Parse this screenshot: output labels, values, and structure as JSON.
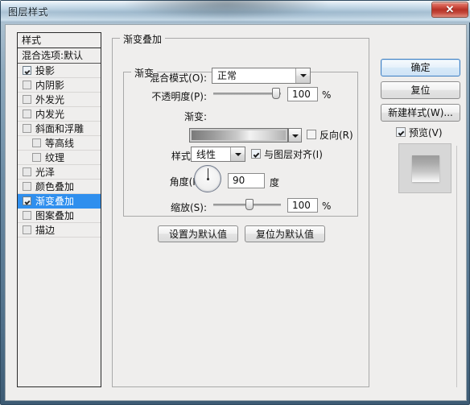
{
  "window": {
    "title": "图层样式",
    "close_label": "✕"
  },
  "styles_panel": {
    "header": "样式",
    "blend_options": "混合选项:默认",
    "effects": [
      {
        "label": "投影",
        "checked": true,
        "selected": false,
        "indent": false
      },
      {
        "label": "内阴影",
        "checked": false,
        "selected": false,
        "indent": false
      },
      {
        "label": "外发光",
        "checked": false,
        "selected": false,
        "indent": false
      },
      {
        "label": "内发光",
        "checked": false,
        "selected": false,
        "indent": false
      },
      {
        "label": "斜面和浮雕",
        "checked": false,
        "selected": false,
        "indent": false
      },
      {
        "label": "等高线",
        "checked": false,
        "selected": false,
        "indent": true
      },
      {
        "label": "纹理",
        "checked": false,
        "selected": false,
        "indent": true
      },
      {
        "label": "光泽",
        "checked": false,
        "selected": false,
        "indent": false
      },
      {
        "label": "颜色叠加",
        "checked": false,
        "selected": false,
        "indent": false
      },
      {
        "label": "渐变叠加",
        "checked": true,
        "selected": true,
        "indent": false
      },
      {
        "label": "图案叠加",
        "checked": false,
        "selected": false,
        "indent": false
      },
      {
        "label": "描边",
        "checked": false,
        "selected": false,
        "indent": false
      }
    ]
  },
  "main": {
    "outer_group_title": "渐变叠加",
    "inner_group_title": "渐变",
    "blend_mode": {
      "label": "混合模式(O):",
      "value": "正常"
    },
    "opacity": {
      "label": "不透明度(P):",
      "value": "100",
      "unit": "%",
      "slider_percent": 100
    },
    "gradient": {
      "label": "渐变:",
      "reverse_label": "反向(R)",
      "reverse_checked": false
    },
    "style": {
      "label": "样式(L):",
      "value": "线性",
      "align_label": "与图层对齐(I)",
      "align_checked": true
    },
    "angle": {
      "label": "角度(N):",
      "value": "90",
      "unit": "度",
      "degrees": 90
    },
    "scale": {
      "label": "缩放(S):",
      "value": "100",
      "unit": "%",
      "slider_percent": 55
    },
    "set_default_button": "设置为默认值",
    "reset_default_button": "复位为默认值"
  },
  "right": {
    "ok_button": "确定",
    "reset_button": "复位",
    "new_style_button": "新建样式(W)...",
    "preview_label": "预览(V)",
    "preview_checked": true
  },
  "colors": {
    "selection_blue": "#2f8fee",
    "default_button_border": "#3d7fc2",
    "close_red": "#b63227",
    "dialog_bg": "#efeeed"
  }
}
